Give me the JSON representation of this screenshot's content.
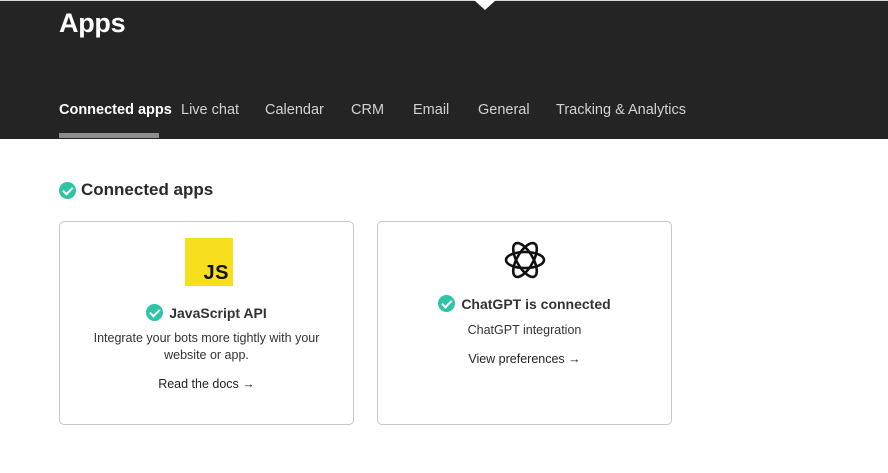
{
  "header": {
    "title": "Apps"
  },
  "tabs": [
    {
      "label": "Connected apps",
      "active": true
    },
    {
      "label": "Live chat",
      "active": false
    },
    {
      "label": "Calendar",
      "active": false
    },
    {
      "label": "CRM",
      "active": false
    },
    {
      "label": "Email",
      "active": false
    },
    {
      "label": "General",
      "active": false
    },
    {
      "label": "Tracking & Analytics",
      "active": false
    }
  ],
  "section": {
    "title": "Connected apps",
    "icon": "check-circle-icon"
  },
  "cards": [
    {
      "logo_text": "JS",
      "logo_color": "#f7df1e",
      "title": "JavaScript API",
      "description": "Integrate your bots more tightly with your website or app.",
      "link": "Read the docs →"
    },
    {
      "logo_icon": "openai-icon",
      "title": "ChatGPT is connected",
      "description": "ChatGPT integration",
      "link": "View preferences →"
    }
  ],
  "colors": {
    "header_bg": "#242424",
    "check": "#2ec4a6"
  }
}
